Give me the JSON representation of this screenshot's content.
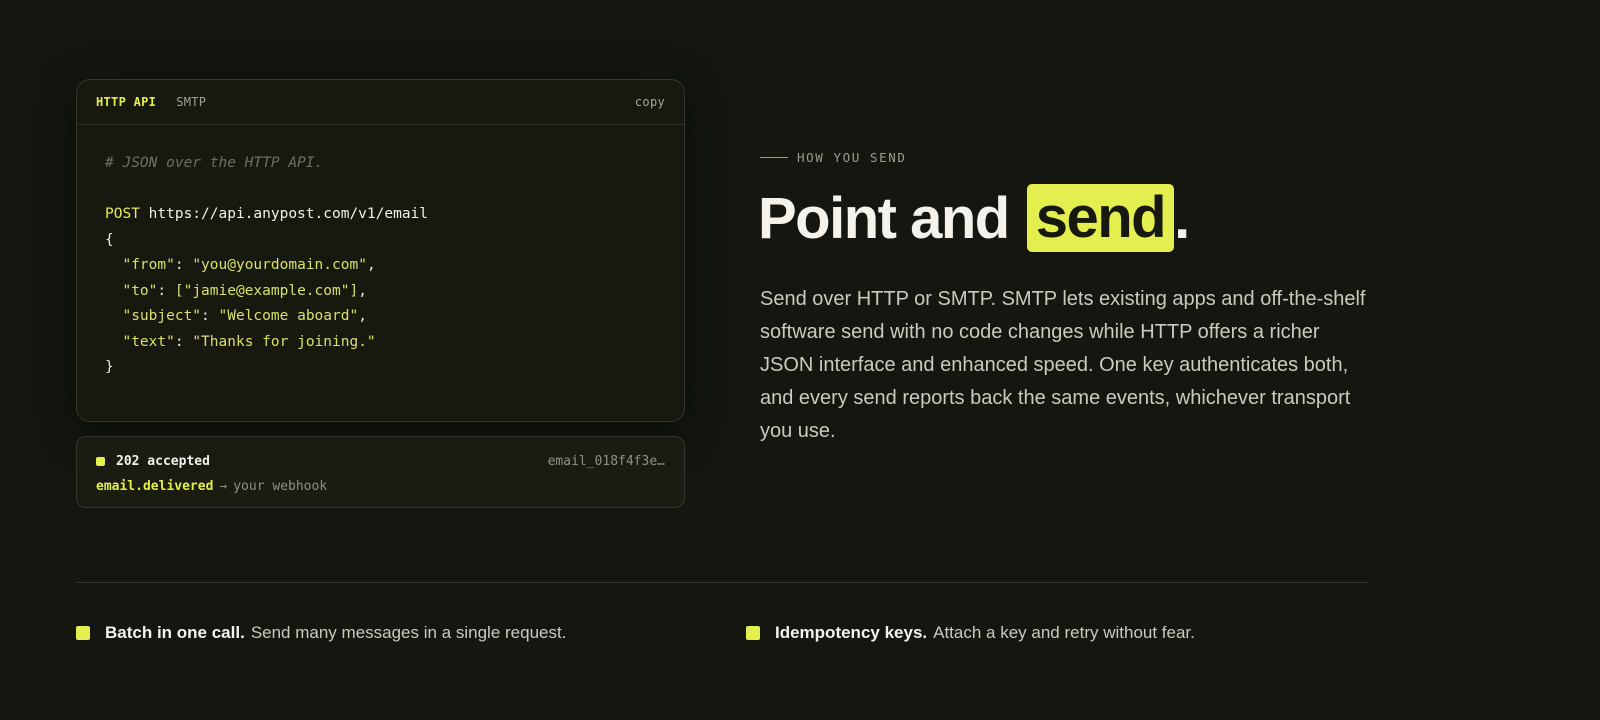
{
  "code_card": {
    "tabs": [
      {
        "label": "HTTP API",
        "active": true
      },
      {
        "label": "SMTP",
        "active": false
      }
    ],
    "copy_label": "copy",
    "comment": "# JSON over the HTTP API.",
    "method": "POST",
    "url": "https://api.anypost.com/v1/email",
    "open_brace": "{",
    "close_brace": "}",
    "fields": [
      {
        "key": "\"from\"",
        "value": "\"you@yourdomain.com\"",
        "suffix": ","
      },
      {
        "key": "\"to\"",
        "value": "[\"jamie@example.com\"]",
        "suffix": ","
      },
      {
        "key": "\"subject\"",
        "value": "\"Welcome aboard\"",
        "suffix": ","
      },
      {
        "key": "\"text\"",
        "value": "\"Thanks for joining.\"",
        "suffix": ""
      }
    ]
  },
  "status_card": {
    "status": "202 accepted",
    "email_id": "email_018f4f3e…",
    "event": "email.delivered",
    "arrow": "→",
    "target": "your webhook"
  },
  "section": {
    "eyebrow": "HOW YOU SEND",
    "headline_pre": "Point and",
    "headline_mark": "send",
    "headline_post": ".",
    "description": "Send over HTTP or SMTP. SMTP lets existing apps and off-the-shelf software send with no code changes while HTTP offers a richer JSON interface and enhanced speed. One key authenticates both, and every send reports back the same events, whichever transport you use."
  },
  "features": [
    {
      "title": "Batch in one call.",
      "desc": "Send many messages in a single request."
    },
    {
      "title": "Idempotency keys.",
      "desc": "Attach a key and retry without fear."
    }
  ],
  "colors": {
    "background": "#14160f",
    "accent": "#e3ef4f",
    "card_border": "#34372b"
  }
}
